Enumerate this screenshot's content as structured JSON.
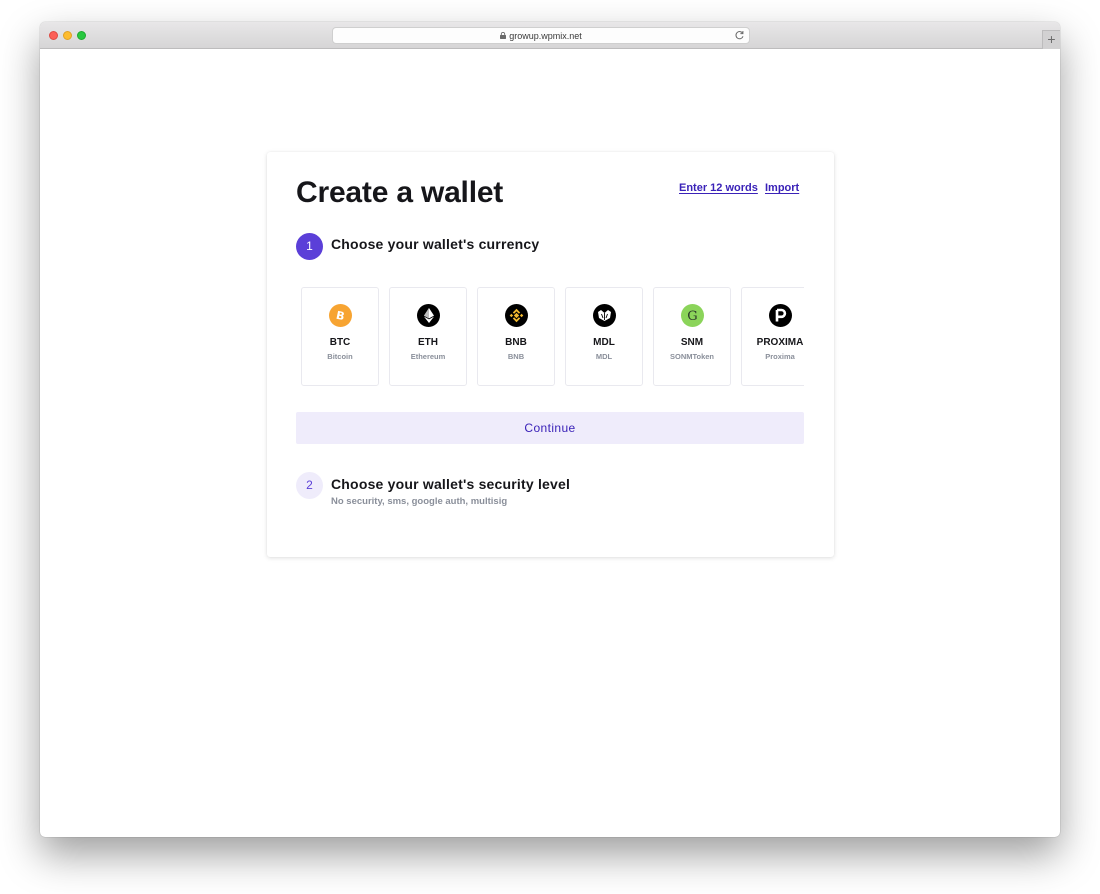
{
  "browser": {
    "url": "growup.wpmix.net",
    "new_tab_label": "+"
  },
  "header": {
    "title": "Create a wallet",
    "links": [
      "Enter 12 words",
      "Import"
    ]
  },
  "step1": {
    "number": "1",
    "title": "Choose your wallet's currency",
    "currencies": [
      {
        "symbol": "BTC",
        "name": "Bitcoin",
        "icon": "bitcoin-icon",
        "color": "#f7a432"
      },
      {
        "symbol": "ETH",
        "name": "Ethereum",
        "icon": "ethereum-icon",
        "color": "#000000"
      },
      {
        "symbol": "BNB",
        "name": "BNB",
        "icon": "binance-icon",
        "color": "#000000"
      },
      {
        "symbol": "MDL",
        "name": "MDL",
        "icon": "mdl-icon",
        "color": "#000000"
      },
      {
        "symbol": "SNM",
        "name": "SONMToken",
        "icon": "sonm-icon",
        "color": "#8bd45a"
      },
      {
        "symbol": "PROXIMA",
        "name": "Proxima",
        "icon": "proxima-icon",
        "color": "#000000"
      }
    ],
    "continue_label": "Continue"
  },
  "step2": {
    "number": "2",
    "title": "Choose your wallet's security level",
    "subtitle": "No security, sms, google auth, multisig"
  },
  "colors": {
    "accent": "#5b3fd8",
    "link": "#3a22b8",
    "accent_light": "#efecfb"
  }
}
